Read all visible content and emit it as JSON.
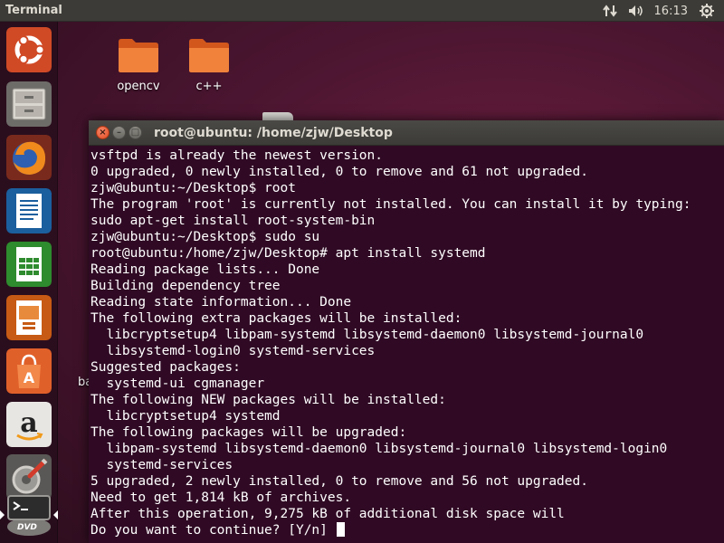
{
  "panel": {
    "app_title": "Terminal",
    "clock": "16:13",
    "indicators": [
      "network-arrows-icon",
      "volume-icon",
      "settings-gear-icon"
    ]
  },
  "launcher": {
    "items": [
      {
        "name": "ubuntu-dash-icon",
        "tooltip": "Search your computer"
      },
      {
        "name": "files-icon",
        "tooltip": "Files"
      },
      {
        "name": "firefox-icon",
        "tooltip": "Firefox Web Browser"
      },
      {
        "name": "writer-icon",
        "tooltip": "LibreOffice Writer"
      },
      {
        "name": "calc-icon",
        "tooltip": "LibreOffice Calc"
      },
      {
        "name": "impress-icon",
        "tooltip": "LibreOffice Impress"
      },
      {
        "name": "software-center-icon",
        "tooltip": "Ubuntu Software"
      },
      {
        "name": "amazon-icon",
        "tooltip": "Amazon"
      },
      {
        "name": "system-settings-icon",
        "tooltip": "System Settings"
      },
      {
        "name": "terminal-icon",
        "tooltip": "Terminal"
      }
    ],
    "dvd_label": "DVD"
  },
  "desktop": {
    "folders": [
      {
        "label": "opencv"
      },
      {
        "label": "c++"
      }
    ],
    "partial_label": "ba"
  },
  "terminal": {
    "title": "root@ubuntu: /home/zjw/Desktop",
    "lines": [
      "vsftpd is already the newest version.",
      "0 upgraded, 0 newly installed, 0 to remove and 61 not upgraded.",
      "zjw@ubuntu:~/Desktop$ root",
      "The program 'root' is currently not installed. You can install it by typing:",
      "sudo apt-get install root-system-bin",
      "zjw@ubuntu:~/Desktop$ sudo su",
      "root@ubuntu:/home/zjw/Desktop# apt install systemd",
      "Reading package lists... Done",
      "Building dependency tree",
      "Reading state information... Done",
      "The following extra packages will be installed:",
      "  libcryptsetup4 libpam-systemd libsystemd-daemon0 libsystemd-journal0",
      "  libsystemd-login0 systemd-services",
      "Suggested packages:",
      "  systemd-ui cgmanager",
      "The following NEW packages will be installed:",
      "  libcryptsetup4 systemd",
      "The following packages will be upgraded:",
      "  libpam-systemd libsystemd-daemon0 libsystemd-journal0 libsystemd-login0",
      "  systemd-services",
      "5 upgraded, 2 newly installed, 0 to remove and 56 not upgraded.",
      "Need to get 1,814 kB of archives.",
      "After this operation, 9,275 kB of additional disk space will"
    ],
    "prompt_line": "Do you want to continue? [Y/n] "
  }
}
